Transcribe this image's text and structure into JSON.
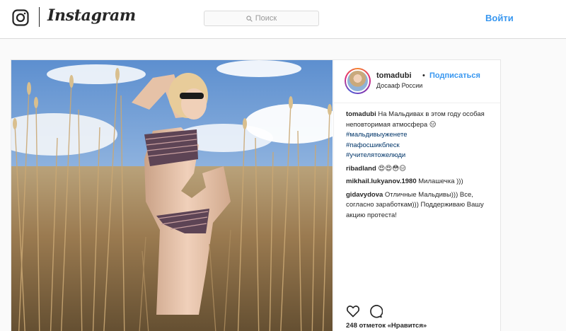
{
  "header": {
    "brand": "Instagram",
    "search_placeholder": "Поиск",
    "login_label": "Войти"
  },
  "post": {
    "username": "tomadubi",
    "separator": "•",
    "follow_label": "Подписаться",
    "location": "Досааф России",
    "caption": {
      "username": "tomadubi",
      "text": "На Мальдивах в этом году особая неповторимая атмосфера 😑",
      "hashtags": [
        "#мальдивыуженете",
        "#пафосшикблеск",
        "#учителятожелюди"
      ]
    },
    "comments": [
      {
        "username": "ribadland",
        "text": "😍😍😳😑"
      },
      {
        "username": "mikhail.lukyanov.1980",
        "text": "Милашечка )))"
      },
      {
        "username": "gidavydova",
        "text": "Отличные Мальдивы))) Все, согласно заработкам))) Поддерживаю Вашу акцию протеста!"
      }
    ],
    "likes_text": "248 отметок «Нравится»"
  },
  "colors": {
    "accent": "#3897f0",
    "hashtag": "#003569",
    "border": "#dbdbdb"
  },
  "icons": [
    "instagram-camera-icon",
    "search-icon",
    "heart-icon",
    "comment-icon"
  ]
}
